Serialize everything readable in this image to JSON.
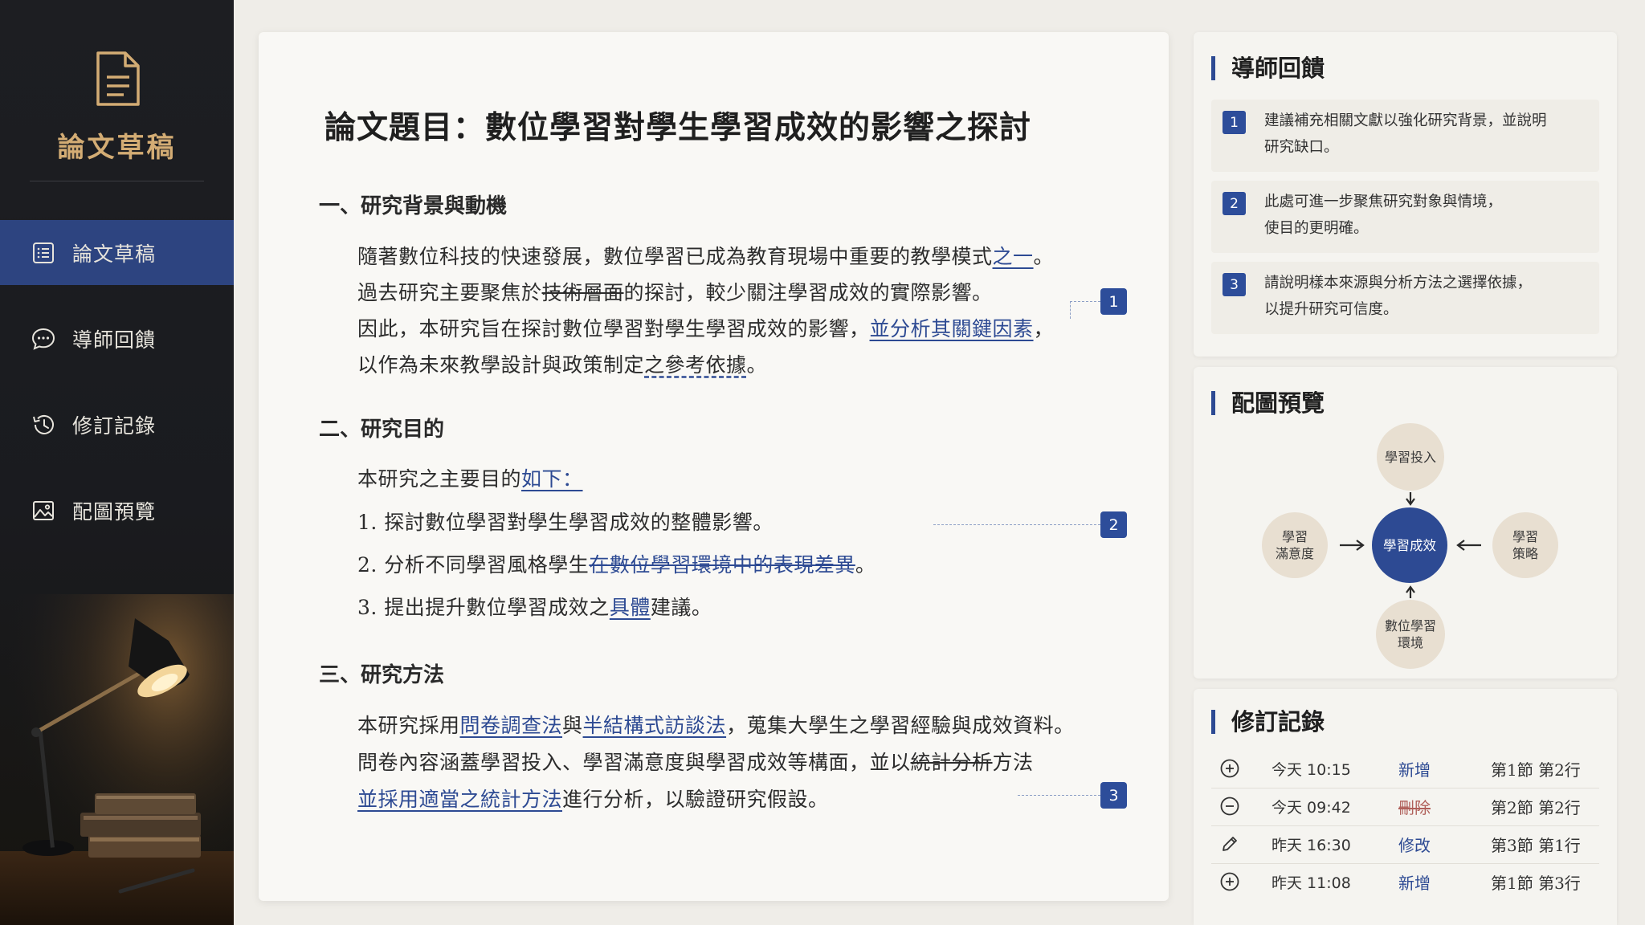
{
  "sidebar": {
    "brand_title": "論文草稿",
    "items": [
      {
        "label": "論文草稿",
        "icon": "document-list-icon",
        "active": true
      },
      {
        "label": "導師回饋",
        "icon": "chat-bubble-icon",
        "active": false
      },
      {
        "label": "修訂記錄",
        "icon": "history-icon",
        "active": false
      },
      {
        "label": "配圖預覽",
        "icon": "image-icon",
        "active": false
      }
    ]
  },
  "document": {
    "title": "論文題目：數位學習對學生學習成效的影響之探討",
    "section1": {
      "heading": "一、研究背景與動機",
      "l1a": "隨著數位科技的快速發展，數位學習已成為教育現場中重要的教學模式",
      "l1b": "之一",
      "l1c": "。",
      "l2a": "過去研究主要聚焦於",
      "l2b": "技術層面",
      "l2c": "的探討，較少關注學習成效的實際影響。",
      "l3a": "因此，本研究旨在探討數位學習對學生學習成效的影響，",
      "l3b": "並分析其關鍵因素",
      "l3c": "，",
      "l4a": "以作為未來教學設計與政策制定",
      "l4b": "之參考依據",
      "l4c": "。"
    },
    "section2": {
      "heading": "二、研究目的",
      "l1a": "本研究之主要目的",
      "l1b": "如下：",
      "l2": "1. 探討數位學習對學生學習成效的整體影響。",
      "l3a": "2. 分析不同學習風格學生",
      "l3b": "在數位學習環境中的表現差異",
      "l3c": "。",
      "l4a": "3. 提出提升數位學習成效之",
      "l4b": "具體",
      "l4c": "建議。"
    },
    "section3": {
      "heading": "三、研究方法",
      "l1a": "本研究採用",
      "l1b": "問卷調查法",
      "l1c": "與",
      "l1d": "半結構式訪談法",
      "l1e": "，蒐集大學生之學習經驗與成效資料。",
      "l2a": "問卷內容涵蓋學習投入、學習滿意度與學習成效等構面，並以",
      "l2b": "統計分析",
      "l2c": "方法",
      "l3a": "並採用適當之統計方法",
      "l3b": "進行分析，以驗證研究假設。"
    },
    "markers": [
      "1",
      "2",
      "3"
    ]
  },
  "feedback": {
    "title": "導師回饋",
    "items": [
      {
        "num": "1",
        "line1": "建議補充相關文獻以強化研究背景，並說明",
        "line2": "研究缺口。"
      },
      {
        "num": "2",
        "line1": "此處可進一步聚焦研究對象與情境，",
        "line2": "使目的更明確。"
      },
      {
        "num": "3",
        "line1": "請說明樣本來源與分析方法之選擇依據，",
        "line2": "以提升研究可信度。"
      }
    ]
  },
  "figure": {
    "title": "配圖預覽",
    "center": "學習成效",
    "top": "學習投入",
    "left_l1": "學習",
    "left_l2": "滿意度",
    "right_l1": "學習",
    "right_l2": "策略",
    "bottom_l1": "數位學習",
    "bottom_l2": "環境"
  },
  "revisions": {
    "title": "修訂記錄",
    "rows": [
      {
        "icon": "plus-circle-icon",
        "time": "今天 10:15",
        "type": "新增",
        "loc": "第1節 第2行",
        "color": "#2d4a93"
      },
      {
        "icon": "minus-circle-icon",
        "time": "今天 09:42",
        "type": "刪除",
        "loc": "第2節 第2行",
        "color": "#b0605a"
      },
      {
        "icon": "pencil-icon",
        "time": "昨天 16:30",
        "type": "修改",
        "loc": "第3節 第1行",
        "color": "#2d4a93"
      },
      {
        "icon": "plus-circle-icon",
        "time": "昨天 11:08",
        "type": "新增",
        "loc": "第1節 第3行",
        "color": "#2d4a93"
      }
    ]
  },
  "colors": {
    "accent": "#2d4a93",
    "sidebar_bg": "#1d1e22",
    "brand_gold": "#d3ac74",
    "delete_red": "#b0605a"
  }
}
